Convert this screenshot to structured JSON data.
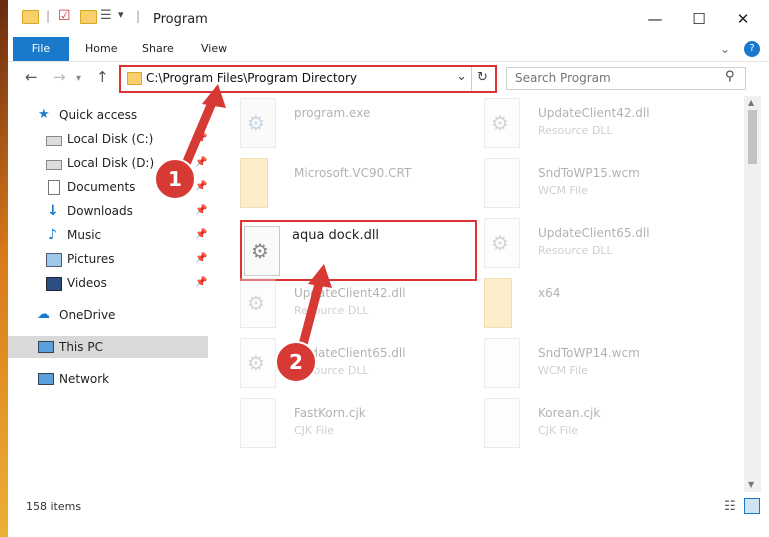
{
  "window": {
    "title": "Program",
    "buttons": {
      "minimize": "—",
      "maximize": "☐",
      "close": "✕"
    }
  },
  "ribbon": {
    "tabs": [
      "File",
      "Home",
      "Share",
      "View"
    ],
    "help": "?"
  },
  "nav": {
    "back": "←",
    "forward": "→",
    "up": "↑",
    "address": "C:\\Program Files\\Program Directory",
    "dropdown": "⌄",
    "refresh": "↻",
    "search_placeholder": "Search Program"
  },
  "sidebar": {
    "items": [
      {
        "label": "Quick access",
        "icon": "star-icon"
      },
      {
        "label": "Local Disk (C:)",
        "icon": "drive-icon",
        "pinned": true
      },
      {
        "label": "Local Disk (D:)",
        "icon": "drive-icon",
        "pinned": true
      },
      {
        "label": "Documents",
        "icon": "documents-icon",
        "pinned": true
      },
      {
        "label": "Downloads",
        "icon": "download-icon",
        "pinned": true
      },
      {
        "label": "Music",
        "icon": "music-icon",
        "pinned": true
      },
      {
        "label": "Pictures",
        "icon": "pictures-icon",
        "pinned": true
      },
      {
        "label": "Videos",
        "icon": "videos-icon",
        "pinned": true
      },
      {
        "label": "OneDrive",
        "icon": "cloud-icon"
      },
      {
        "label": "This PC",
        "icon": "computer-icon",
        "selected": true
      },
      {
        "label": "Network",
        "icon": "network-icon"
      }
    ],
    "pin_glyph": "📌"
  },
  "files": [
    {
      "name": "program.exe",
      "type": "",
      "icon": "exe"
    },
    {
      "name": "UpdateClient42.dll",
      "type": "Resource DLL",
      "icon": "gear"
    },
    {
      "name": "Microsoft.VC90.CRT",
      "type": "",
      "icon": "folder"
    },
    {
      "name": "SndToWP15.wcm",
      "type": "WCM File",
      "icon": "blank"
    },
    {
      "name": "aqua dock.dll",
      "type": "",
      "icon": "gear",
      "highlighted": true
    },
    {
      "name": "UpdateClient65.dll",
      "type": "Resource DLL",
      "icon": "gear"
    },
    {
      "name": "UpdateClient42.dll",
      "type": "Resource DLL",
      "icon": "gear"
    },
    {
      "name": "x64",
      "type": "",
      "icon": "folder"
    },
    {
      "name": "UpdateClient65.dll",
      "type": "Resource DLL",
      "icon": "gear"
    },
    {
      "name": "SndToWP14.wcm",
      "type": "WCM File",
      "icon": "blank"
    },
    {
      "name": "FastKorn.cjk",
      "type": "CJK File",
      "icon": "blank"
    },
    {
      "name": "Korean.cjk",
      "type": "CJK File",
      "icon": "blank"
    }
  ],
  "status": {
    "item_count": "158 items"
  },
  "callouts": [
    "1",
    "2"
  ],
  "colors": {
    "accent": "#1979ca",
    "highlight": "#dd3333",
    "badge": "#d73a35"
  }
}
